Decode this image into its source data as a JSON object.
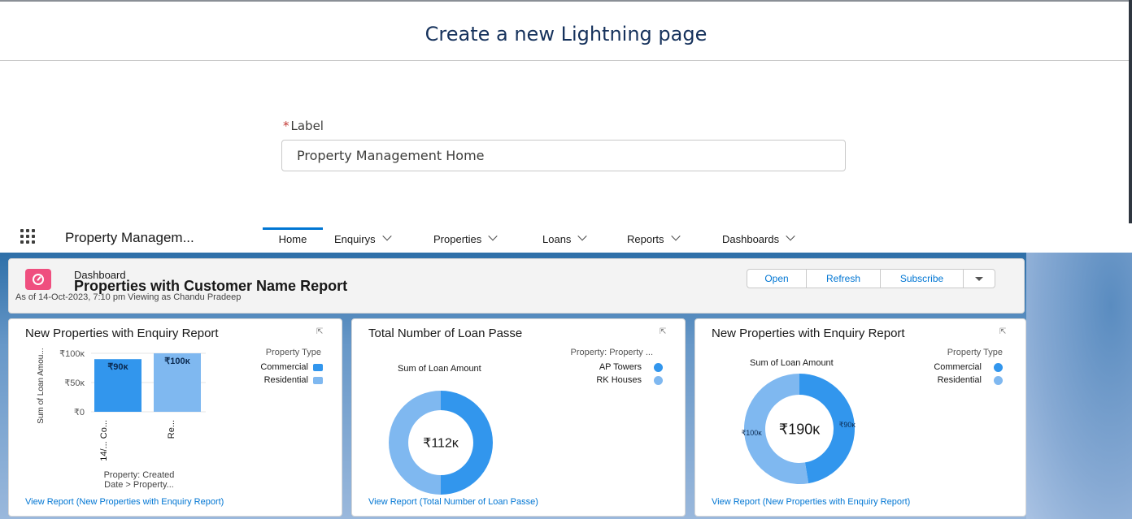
{
  "modal": {
    "title": "Create a new Lightning page",
    "label_required_marker": "*",
    "label_text": "Label",
    "label_value": "Property Management Home"
  },
  "nav": {
    "app_name": "Property Managem...",
    "tabs": [
      {
        "label": "Home",
        "active": true
      },
      {
        "label": "Enquirys",
        "active": false
      },
      {
        "label": "Properties",
        "active": false
      },
      {
        "label": "Loans",
        "active": false
      },
      {
        "label": "Reports",
        "active": false
      },
      {
        "label": "Dashboards",
        "active": false
      }
    ]
  },
  "dashboard": {
    "type_label": "Dashboard",
    "title": "Properties with Customer Name Report",
    "subtitle": "As of 14-Oct-2023, 7:10 pm Viewing as Chandu Pradeep",
    "buttons": [
      "Open",
      "Refresh",
      "Subscribe"
    ],
    "colors": {
      "primary": "#3296ed",
      "secondary": "#7fb8f0",
      "link": "#0176d3",
      "dashboard_icon": "#ef4f7f"
    }
  },
  "cards": [
    {
      "title": "New Properties with Enquiry Report",
      "link": "View Report (New Properties with Enquiry Report)",
      "legend_title": "Property Type",
      "legend": [
        "Commercial",
        "Residential"
      ],
      "ylabel": "Sum of Loan Amou...",
      "yticks": [
        "₹100ᴋ",
        "₹50ᴋ",
        "₹0"
      ],
      "xlabels": [
        "14/... Co...",
        "Re..."
      ],
      "xtitle_line1": "Property: Created",
      "xtitle_line2": "Date > Property..."
    },
    {
      "title": "Total Number of Loan Passe",
      "link": "View Report (Total Number of Loan Passe)",
      "legend_title": "Property: Property ...",
      "legend": [
        "AP Towers",
        "RK Houses"
      ],
      "sum_label": "Sum of Loan Amount",
      "center": "₹112ᴋ"
    },
    {
      "title": "New Properties with Enquiry Report",
      "link": "View Report (New Properties with Enquiry Report)",
      "legend_title": "Property Type",
      "legend": [
        "Commercial",
        "Residential"
      ],
      "sum_label": "Sum of Loan Amount",
      "center": "₹190ᴋ",
      "slice_labels": [
        "₹90ᴋ",
        "₹100ᴋ"
      ]
    }
  ],
  "chart_data": [
    {
      "type": "bar",
      "categories": [
        "Commercial",
        "Residential"
      ],
      "values": [
        90,
        100
      ],
      "value_labels": [
        "₹90ᴋ",
        "₹100ᴋ"
      ],
      "ylabel": "Sum of Loan Amou...",
      "ylim": [
        0,
        100
      ],
      "colors": [
        "#3296ed",
        "#7fb8f0"
      ]
    },
    {
      "type": "pie",
      "categories": [
        "AP Towers",
        "RK Houses"
      ],
      "values": [
        56,
        56
      ],
      "total_label": "₹112ᴋ",
      "colors": [
        "#3296ed",
        "#7fb8f0"
      ]
    },
    {
      "type": "pie",
      "categories": [
        "Commercial",
        "Residential"
      ],
      "values": [
        90,
        100
      ],
      "total_label": "₹190ᴋ",
      "colors": [
        "#3296ed",
        "#7fb8f0"
      ]
    }
  ]
}
